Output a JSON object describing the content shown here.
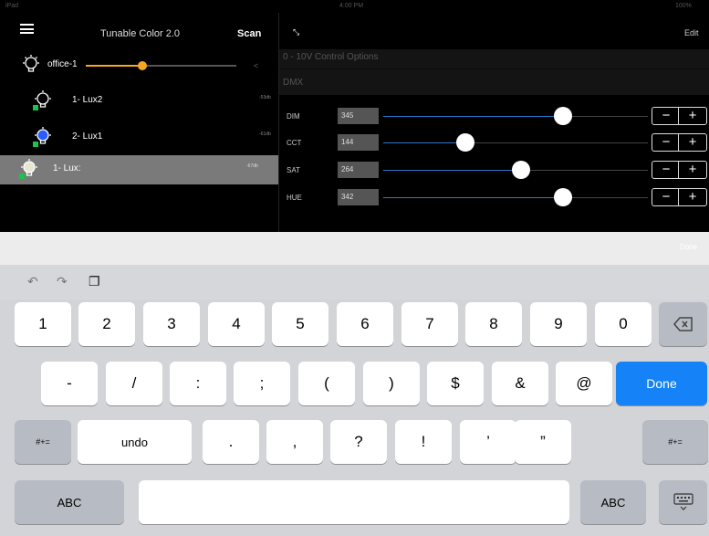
{
  "status": {
    "left": "iPad",
    "center": "4:00 PM",
    "right": "100%"
  },
  "header": {
    "title": "Tunable Color 2.0",
    "scan_label": "Scan",
    "edit_label": "Edit"
  },
  "group": {
    "name": "office-1",
    "level": 0.42
  },
  "devices": [
    {
      "name": "1- Lux2",
      "rssi": "-53db"
    },
    {
      "name": "2- Lux1",
      "rssi": "-61db"
    },
    {
      "name": "1- Lux:",
      "rssi": "-67db"
    }
  ],
  "options": {
    "analog": "0 - 10V Control Options",
    "dmx": "DMX"
  },
  "controls": [
    {
      "label": "DIM",
      "value": "345",
      "level": 0.68
    },
    {
      "label": "CCT",
      "value": "144",
      "level": 0.31
    },
    {
      "label": "SAT",
      "value": "264",
      "level": 0.52
    },
    {
      "label": "HUE",
      "value": "342",
      "level": 0.68
    }
  ],
  "stepper": {
    "minus": "−",
    "plus": "+"
  },
  "keyboard": {
    "done_bar": "Done",
    "row1": [
      "1",
      "2",
      "3",
      "4",
      "5",
      "6",
      "7",
      "8",
      "9",
      "0"
    ],
    "row2": [
      "-",
      "/",
      ":",
      ";",
      "(",
      ")",
      "$",
      "&",
      "@"
    ],
    "done_key": "Done",
    "row3_left": "#+=",
    "undo": "undo",
    "row3": [
      ".",
      ",",
      "?",
      "!",
      "’",
      "”"
    ],
    "row3_right": "#+=",
    "abc": "ABC"
  },
  "colors": {
    "accent": "#1583f7",
    "slider": "#f5a623",
    "bulb_blue": "#2b5cff",
    "bulb_green": "#19c44a"
  },
  "icons": [
    "menu-icon",
    "bulb-icon",
    "expand-icon",
    "undo-icon",
    "redo-icon",
    "paste-icon",
    "delete-icon",
    "keyboard-icon"
  ]
}
